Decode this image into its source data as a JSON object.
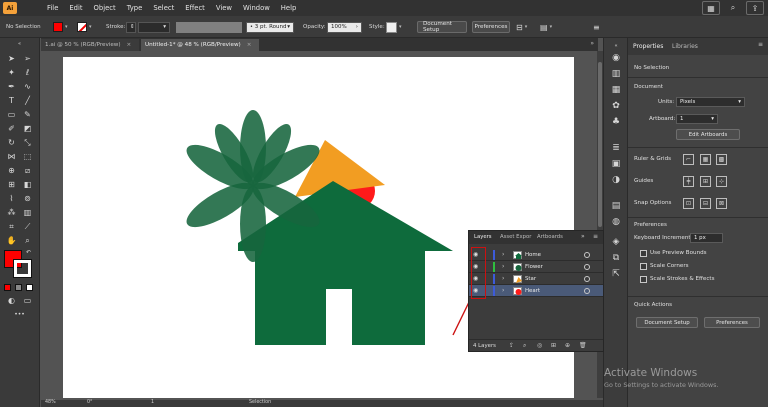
{
  "app": {
    "logo": "Ai"
  },
  "menu": [
    "File",
    "Edit",
    "Object",
    "Type",
    "Select",
    "Effect",
    "View",
    "Window",
    "Help"
  ],
  "controlbar": {
    "selection": "No Selection",
    "stroke_label": "Stroke:",
    "brush": "3 pt. Round",
    "opacity_label": "Opacity:",
    "opacity_value": "100%",
    "style_label": "Style:",
    "document_setup": "Document Setup",
    "preferences": "Preferences",
    "fill_color": "#ff0000"
  },
  "doc_tabs": [
    {
      "label": "1.ai @ 50 % (RGB/Preview)",
      "close": "×"
    },
    {
      "label": "Untitled-1* @ 48 % (RGB/Preview)",
      "close": "×"
    }
  ],
  "properties": {
    "tabs": [
      "Properties",
      "Libraries"
    ],
    "no_selection": "No Selection",
    "document_heading": "Document",
    "units_label": "Units:",
    "units_value": "Pixels",
    "artboard_label": "Artboard:",
    "artboard_value": "1",
    "edit_artboards": "Edit Artboards",
    "ruler_grids": "Ruler & Grids",
    "guides": "Guides",
    "snap_options": "Snap Options",
    "preferences_heading": "Preferences",
    "keyboard_increment_label": "Keyboard Increment:",
    "keyboard_increment_value": "1 px",
    "use_preview_bounds": "Use Preview Bounds",
    "scale_corners": "Scale Corners",
    "scale_strokes": "Scale Strokes & Effects",
    "quick_actions": "Quick Actions",
    "document_setup": "Document Setup",
    "preferences": "Preferences"
  },
  "layers": {
    "tabs": [
      "Layers",
      "Asset Expor",
      "Artboards"
    ],
    "rows": [
      {
        "name": "Home",
        "color": "#3d5bd9"
      },
      {
        "name": "Flower",
        "color": "#2fbf3f"
      },
      {
        "name": "Star",
        "color": "#3d5bd9"
      },
      {
        "name": "Heart",
        "color": "#3d5bd9"
      }
    ],
    "count": "4 Layers"
  },
  "status": {
    "zoom": "48%",
    "rotation": "0°",
    "artboard": "1",
    "tool": "Selection"
  },
  "watermark": {
    "title": "Activate Windows",
    "subtitle": "Go to Settings to activate Windows."
  },
  "colors": {
    "house": "#0e6b3c",
    "flower": "#17653d",
    "star": "#f29d22",
    "heart": "#ff1a1a",
    "annotation": "#cc1111"
  }
}
